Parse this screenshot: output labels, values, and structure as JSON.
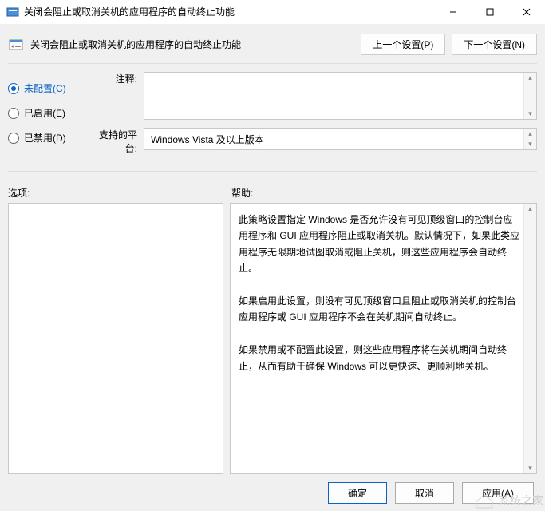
{
  "window": {
    "title": "关闭会阻止或取消关机的应用程序的自动终止功能",
    "minimize_tip": "Minimize",
    "maximize_tip": "Maximize",
    "close_tip": "Close"
  },
  "header": {
    "title": "关闭会阻止或取消关机的应用程序的自动终止功能",
    "prev_btn": "上一个设置(P)",
    "next_btn": "下一个设置(N)"
  },
  "radios": {
    "not_configured": "未配置(C)",
    "enabled": "已启用(E)",
    "disabled": "已禁用(D)",
    "selected": "not_configured"
  },
  "labels": {
    "comment": "注释:",
    "platform": "支持的平台:",
    "options": "选项:",
    "help": "帮助:"
  },
  "fields": {
    "comment_value": "",
    "platform_value": "Windows Vista 及以上版本"
  },
  "help_text": {
    "p1": "此策略设置指定 Windows 是否允许没有可见顶级窗口的控制台应用程序和 GUI 应用程序阻止或取消关机。默认情况下，如果此类应用程序无限期地试图取消或阻止关机，则这些应用程序会自动终止。",
    "p2": "如果启用此设置，则没有可见顶级窗口且阻止或取消关机的控制台应用程序或 GUI 应用程序不会在关机期间自动终止。",
    "p3": "如果禁用或不配置此设置，则这些应用程序将在关机期间自动终止，从而有助于确保 Windows 可以更快速、更顺利地关机。"
  },
  "footer": {
    "ok": "确定",
    "cancel": "取消",
    "apply": "应用(A)"
  },
  "watermark": "系统之家"
}
